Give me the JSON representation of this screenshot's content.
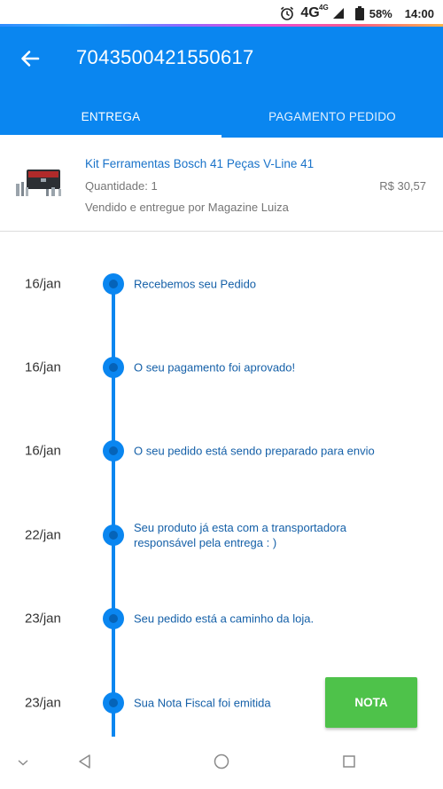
{
  "status_bar": {
    "network": "4G",
    "network_sup": "4G",
    "battery": "58%",
    "time": "14:00"
  },
  "header": {
    "order_number": "7043500421550617",
    "tabs": [
      {
        "label": "ENTREGA",
        "active": true
      },
      {
        "label": "PAGAMENTO PEDIDO",
        "active": false
      }
    ]
  },
  "product": {
    "name": "Kit Ferramentas Bosch 41 Peças V-Line 41",
    "quantity": "Quantidade: 1",
    "price": "R$ 30,57",
    "seller": "Vendido e entregue por Magazine Luiza"
  },
  "timeline": [
    {
      "date": "16/jan",
      "text": "Recebemos seu Pedido"
    },
    {
      "date": "16/jan",
      "text": "O seu pagamento foi aprovado!"
    },
    {
      "date": "16/jan",
      "text": "O seu pedido está sendo preparado para envio"
    },
    {
      "date": "22/jan",
      "text": "Seu produto já esta com a transportadora responsável pela entrega : )"
    },
    {
      "date": "23/jan",
      "text": "Seu pedido está a caminho da loja."
    },
    {
      "date": "23/jan",
      "text": "Sua Nota Fiscal foi emitida"
    }
  ],
  "actions": {
    "nota_label": "NOTA"
  },
  "colors": {
    "primary": "#0a86f0",
    "accent_green": "#4ec24a",
    "link_text": "#1a73c9"
  },
  "icons": {
    "back": "arrow-left-icon",
    "alarm": "alarm-clock-icon",
    "signal": "signal-icon",
    "battery": "battery-icon"
  }
}
